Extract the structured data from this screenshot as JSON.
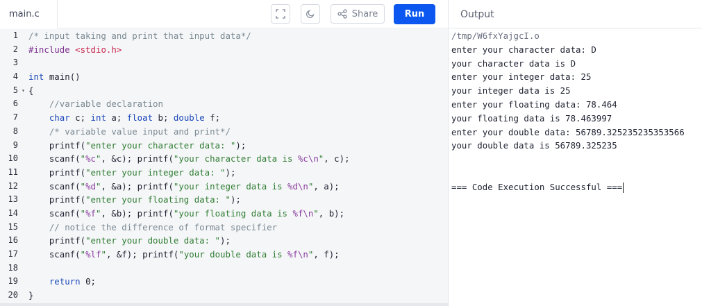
{
  "tab": {
    "filename": "main.c"
  },
  "toolbar": {
    "share_label": "Share",
    "run_label": "Run"
  },
  "icons": {
    "fullscreen": "fullscreen-icon",
    "theme": "moon-icon",
    "share": "share-icon"
  },
  "colors": {
    "run_button": "#0b57f0"
  },
  "output": {
    "title": "Output",
    "path": "/tmp/W6fxYajgcI.o",
    "lines": [
      "enter your character data: D",
      "your character data is D",
      "enter your integer data: 25",
      "your integer data is 25",
      "enter your floating data: 78.464",
      "your floating data is 78.463997",
      "enter your double data: 56789.325235235353566",
      "your double data is 56789.325235",
      "",
      "",
      "=== Code Execution Successful ==="
    ]
  },
  "editor": {
    "line_numbers": [
      "1",
      "2",
      "3",
      "4",
      "5",
      "6",
      "7",
      "8",
      "9",
      "10",
      "11",
      "12",
      "13",
      "14",
      "15",
      "16",
      "17",
      "18",
      "19",
      "20"
    ],
    "lines": [
      [
        {
          "t": "/* input taking and print that input data*/",
          "c": "comment"
        }
      ],
      [
        {
          "t": "#include ",
          "c": "pre"
        },
        {
          "t": "<stdio.h>",
          "c": "inc"
        }
      ],
      [],
      [
        {
          "t": "int",
          "c": "type"
        },
        {
          "t": " main()",
          "c": "plain"
        }
      ],
      [
        {
          "t": "{",
          "c": "plain"
        }
      ],
      [
        {
          "t": "    //variable declaration",
          "c": "comment"
        }
      ],
      [
        {
          "t": "    ",
          "c": "plain"
        },
        {
          "t": "char",
          "c": "type"
        },
        {
          "t": " c; ",
          "c": "plain"
        },
        {
          "t": "int",
          "c": "type"
        },
        {
          "t": " a; ",
          "c": "plain"
        },
        {
          "t": "float",
          "c": "type"
        },
        {
          "t": " b; ",
          "c": "plain"
        },
        {
          "t": "double",
          "c": "type"
        },
        {
          "t": " f;",
          "c": "plain"
        }
      ],
      [
        {
          "t": "    /* variable value input and print*/",
          "c": "comment"
        }
      ],
      [
        {
          "t": "    printf(",
          "c": "plain"
        },
        {
          "t": "\"enter your character data: \"",
          "c": "str"
        },
        {
          "t": ");",
          "c": "plain"
        }
      ],
      [
        {
          "t": "    scanf(",
          "c": "plain"
        },
        {
          "t": "\"",
          "c": "str"
        },
        {
          "t": "%c",
          "c": "fmt"
        },
        {
          "t": "\"",
          "c": "str"
        },
        {
          "t": ", &c); printf(",
          "c": "plain"
        },
        {
          "t": "\"your character data is ",
          "c": "str"
        },
        {
          "t": "%c\\n",
          "c": "fmt"
        },
        {
          "t": "\"",
          "c": "str"
        },
        {
          "t": ", c);",
          "c": "plain"
        }
      ],
      [
        {
          "t": "    printf(",
          "c": "plain"
        },
        {
          "t": "\"enter your integer data: \"",
          "c": "str"
        },
        {
          "t": ");",
          "c": "plain"
        }
      ],
      [
        {
          "t": "    scanf(",
          "c": "plain"
        },
        {
          "t": "\"",
          "c": "str"
        },
        {
          "t": "%d",
          "c": "fmt"
        },
        {
          "t": "\"",
          "c": "str"
        },
        {
          "t": ", &a); printf(",
          "c": "plain"
        },
        {
          "t": "\"your integer data is ",
          "c": "str"
        },
        {
          "t": "%d\\n",
          "c": "fmt"
        },
        {
          "t": "\"",
          "c": "str"
        },
        {
          "t": ", a);",
          "c": "plain"
        }
      ],
      [
        {
          "t": "    printf(",
          "c": "plain"
        },
        {
          "t": "\"enter your floating data: \"",
          "c": "str"
        },
        {
          "t": ");",
          "c": "plain"
        }
      ],
      [
        {
          "t": "    scanf(",
          "c": "plain"
        },
        {
          "t": "\"",
          "c": "str"
        },
        {
          "t": "%f",
          "c": "fmt"
        },
        {
          "t": "\"",
          "c": "str"
        },
        {
          "t": ", &b); printf(",
          "c": "plain"
        },
        {
          "t": "\"your floating data is ",
          "c": "str"
        },
        {
          "t": "%f\\n",
          "c": "fmt"
        },
        {
          "t": "\"",
          "c": "str"
        },
        {
          "t": ", b);",
          "c": "plain"
        }
      ],
      [
        {
          "t": "    // notice the difference of format specifier",
          "c": "comment"
        }
      ],
      [
        {
          "t": "    printf(",
          "c": "plain"
        },
        {
          "t": "\"enter your double data: \"",
          "c": "str"
        },
        {
          "t": ");",
          "c": "plain"
        }
      ],
      [
        {
          "t": "    scanf(",
          "c": "plain"
        },
        {
          "t": "\"",
          "c": "str"
        },
        {
          "t": "%lf",
          "c": "fmt"
        },
        {
          "t": "\"",
          "c": "str"
        },
        {
          "t": ", &f); printf(",
          "c": "plain"
        },
        {
          "t": "\"your double data is ",
          "c": "str"
        },
        {
          "t": "%f\\n",
          "c": "fmt"
        },
        {
          "t": "\"",
          "c": "str"
        },
        {
          "t": ", f);",
          "c": "plain"
        }
      ],
      [],
      [
        {
          "t": "    ",
          "c": "plain"
        },
        {
          "t": "return",
          "c": "type"
        },
        {
          "t": " 0;",
          "c": "plain"
        }
      ],
      [
        {
          "t": "}",
          "c": "plain"
        }
      ]
    ],
    "fold_marker": "▾"
  }
}
